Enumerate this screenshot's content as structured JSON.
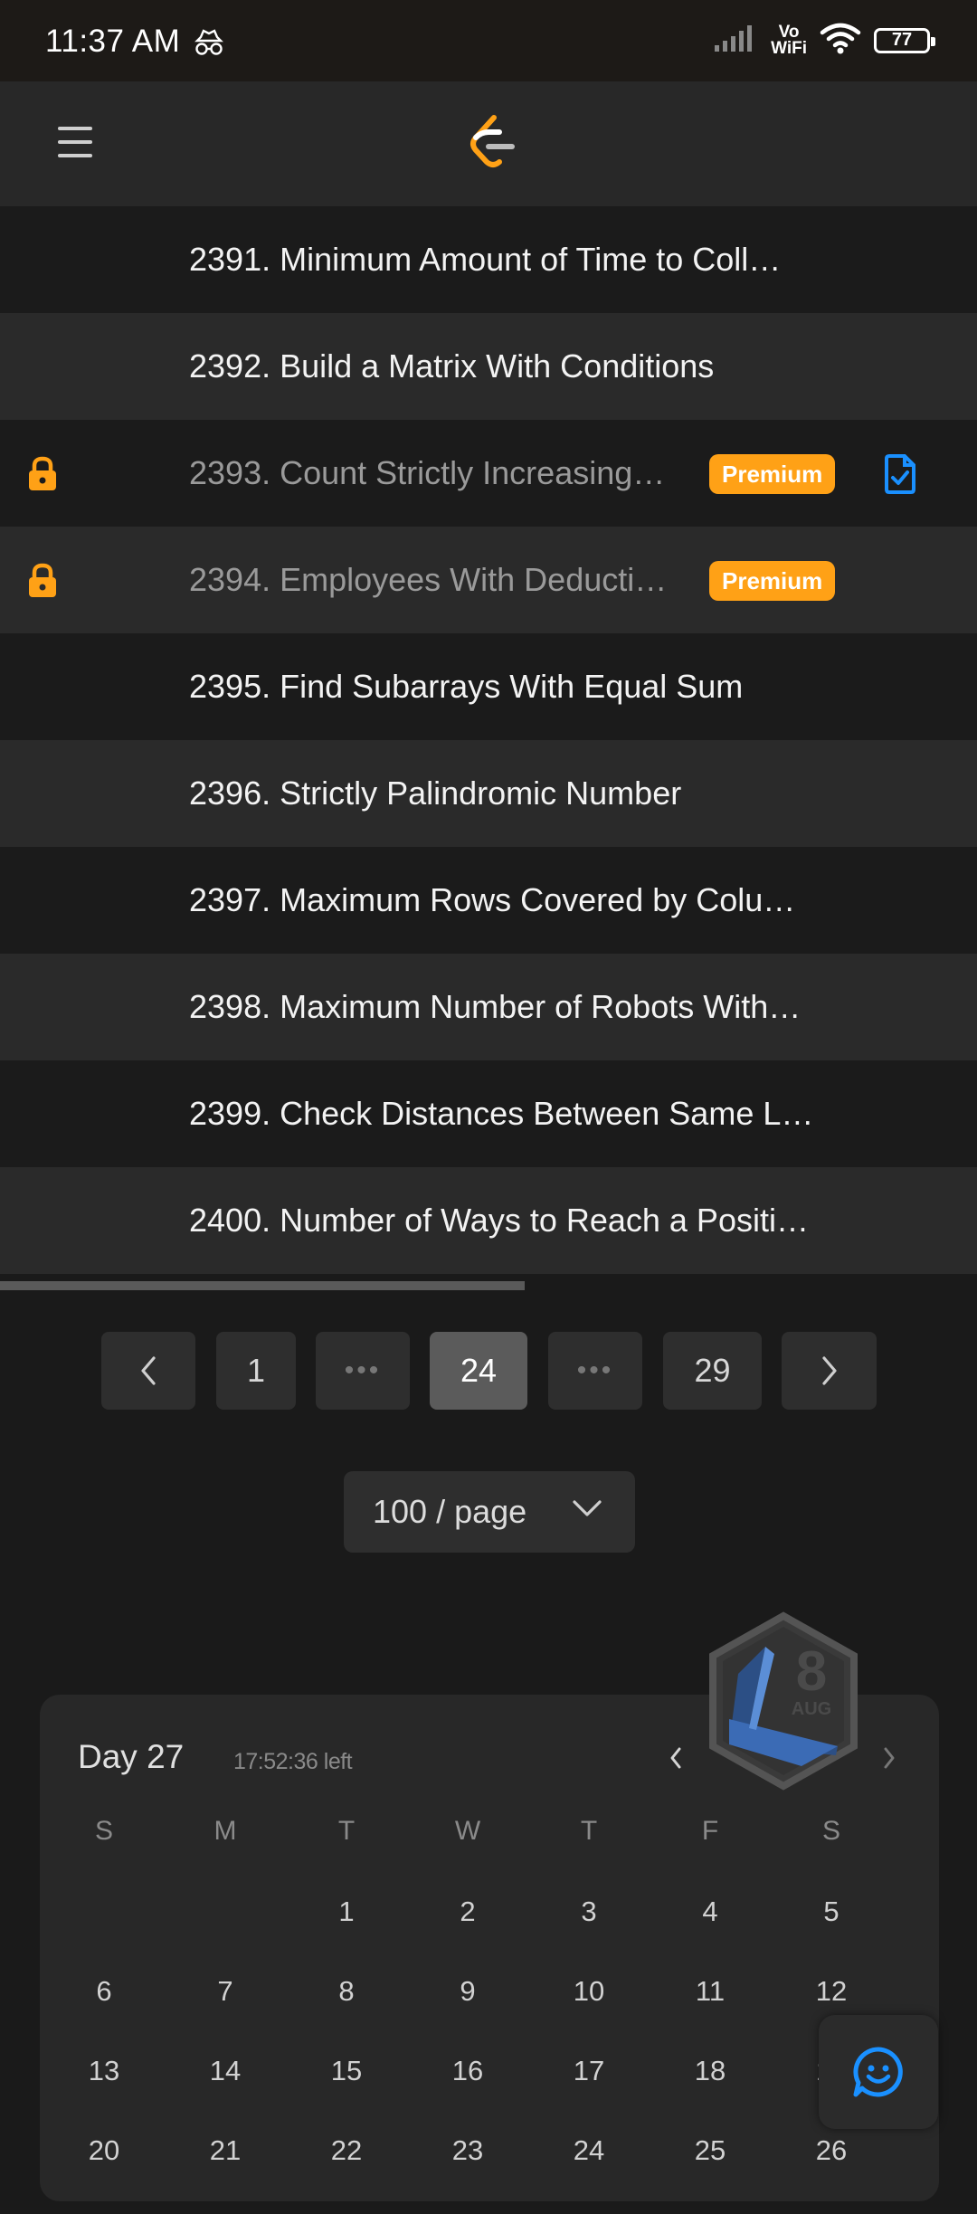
{
  "status_bar": {
    "time": "11:37 AM",
    "network_label_top": "Vo",
    "network_label_bottom": "WiFi",
    "battery": "77",
    "icons": [
      "incognito-icon",
      "signal-icon",
      "wifi-icon",
      "battery-icon"
    ]
  },
  "header": {
    "menu_icon": "hamburger-menu-icon",
    "logo_icon": "leetcode-logo-icon"
  },
  "problems": [
    {
      "title": "2391. Minimum Amount of Time to Coll…",
      "locked": false,
      "premium": false
    },
    {
      "title": "2392. Build a Matrix With Conditions",
      "locked": false,
      "premium": false
    },
    {
      "title": "2393. Count Strictly Increasing…",
      "locked": true,
      "premium": true,
      "premium_label": "Premium",
      "has_solution": true
    },
    {
      "title": "2394. Employees With Deducti…",
      "locked": true,
      "premium": true,
      "premium_label": "Premium"
    },
    {
      "title": "2395. Find Subarrays With Equal Sum",
      "locked": false,
      "premium": false
    },
    {
      "title": "2396. Strictly Palindromic Number",
      "locked": false,
      "premium": false
    },
    {
      "title": "2397. Maximum Rows Covered by Colu…",
      "locked": false,
      "premium": false
    },
    {
      "title": "2398. Maximum Number of Robots With…",
      "locked": false,
      "premium": false
    },
    {
      "title": "2399. Check Distances Between Same L…",
      "locked": false,
      "premium": false
    },
    {
      "title": "2400. Number of Ways to Reach a Positi…",
      "locked": false,
      "premium": false
    }
  ],
  "pagination": {
    "first": "1",
    "ellipsis": "•••",
    "current": "24",
    "last": "29",
    "page_size": "100 / page"
  },
  "calendar": {
    "day_label": "Day 27",
    "time_left": "17:52:36 left",
    "badge_number": "8",
    "badge_month": "AUG",
    "weekdays": [
      "S",
      "M",
      "T",
      "W",
      "T",
      "F",
      "S"
    ],
    "weeks": [
      [
        "",
        "",
        "1",
        "2",
        "3",
        "4",
        "5"
      ],
      [
        "6",
        "7",
        "8",
        "9",
        "10",
        "11",
        "12"
      ],
      [
        "13",
        "14",
        "15",
        "16",
        "17",
        "18",
        "19"
      ],
      [
        "20",
        "21",
        "22",
        "23",
        "24",
        "25",
        "26"
      ]
    ]
  },
  "colors": {
    "accent_orange": "#ffa116",
    "solution_blue": "#1a90ff",
    "background": "#1a1a1a"
  }
}
